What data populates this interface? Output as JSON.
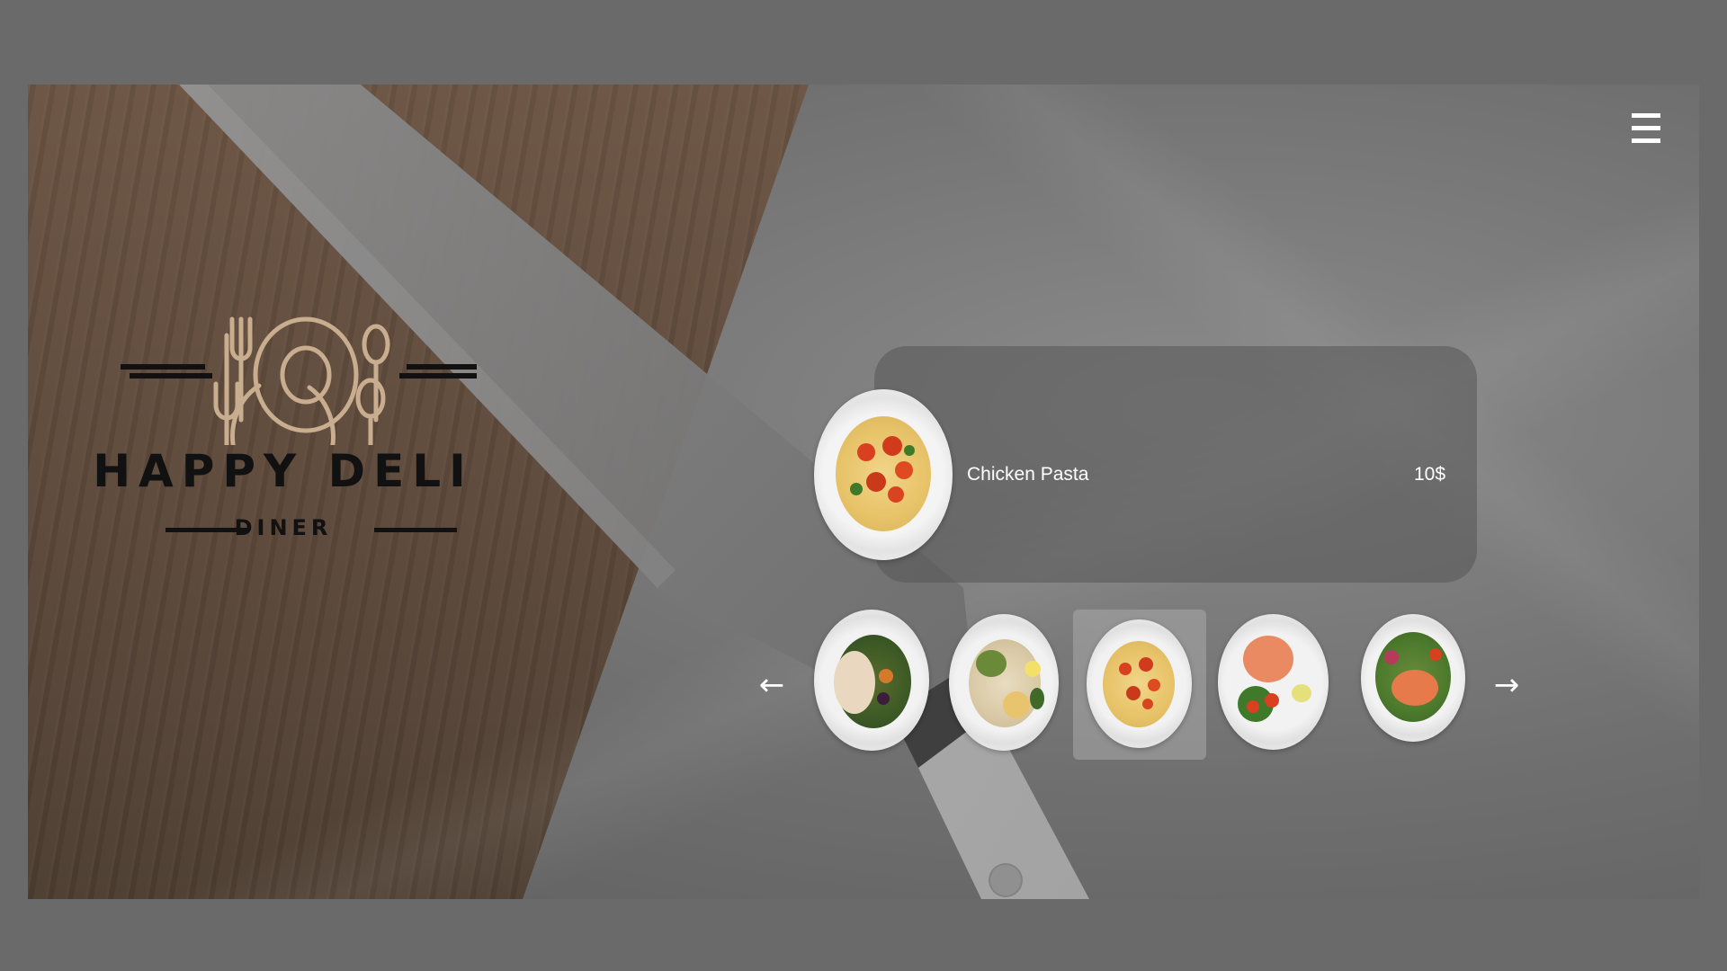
{
  "brand": {
    "name": "HAPPY DELI",
    "subtitle": "DINER",
    "accent_color": "#c8ad8f",
    "logo_icon": "plate-fork-spoon-icon"
  },
  "menu_button": {
    "icon": "hamburger-menu-icon"
  },
  "selected_item": {
    "name": "Chicken Pasta",
    "price": "10$",
    "image": "pasta-plate"
  },
  "carousel": {
    "prev_icon": "arrow-left-icon",
    "next_icon": "arrow-right-icon",
    "prev_glyph": "←",
    "next_glyph": "→",
    "selected_index": 2,
    "items": [
      {
        "image": "chicken-salad-plate"
      },
      {
        "image": "chicken-rice-hummus-plate"
      },
      {
        "image": "pasta-plate"
      },
      {
        "image": "salmon-tomato-plate"
      },
      {
        "image": "salmon-salad-plate"
      }
    ]
  }
}
